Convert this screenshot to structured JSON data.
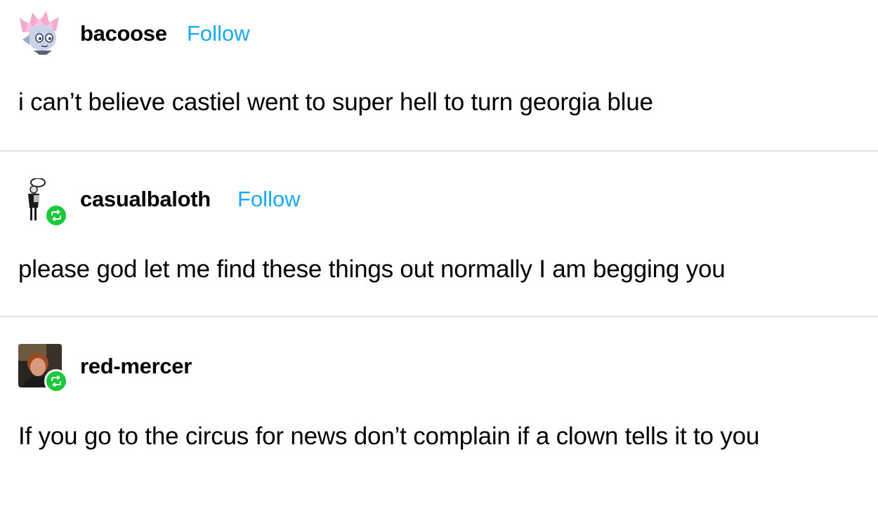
{
  "posts": [
    {
      "username": "bacoose",
      "follow_label": "Follow",
      "avatar_icon": "pink-haired-character-avatar",
      "reblogged": false,
      "text": "i can’t believe castiel went to super hell to turn georgia blue"
    },
    {
      "username": "casualbaloth",
      "follow_label": "Follow",
      "avatar_icon": "tuba-player-avatar",
      "reblogged": true,
      "text": "please god let me find these things out normally I am begging you"
    },
    {
      "username": "red-mercer",
      "avatar_icon": "photo-avatar",
      "reblogged": true,
      "text": "If you go to the circus for news don’t complain if a clown tells it to you"
    }
  ],
  "colors": {
    "follow_link": "#18a9f2",
    "reblog_badge": "#19c93b",
    "divider": "#e0e0e0"
  }
}
